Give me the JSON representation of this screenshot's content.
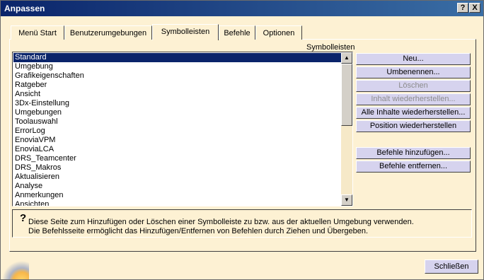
{
  "window": {
    "title": "Anpassen",
    "help_label": "?",
    "close_label": "X"
  },
  "tabs": [
    {
      "label": "Menü Start"
    },
    {
      "label": "Benutzerumgebungen"
    },
    {
      "label": "Symbolleisten"
    },
    {
      "label": "Befehle"
    },
    {
      "label": "Optionen"
    }
  ],
  "active_tab": "Symbolleisten",
  "toolbars": {
    "title": "Symbolleisten",
    "selected": "Standard",
    "items": [
      "Standard",
      "Umgebung",
      "Grafikeigenschaften",
      "Ratgeber",
      "Ansicht",
      "3Dx-Einstellung",
      "Umgebungen",
      "Toolauswahl",
      "ErrorLog",
      "EnoviaVPM",
      "EnoviaLCA",
      "DRS_Teamcenter",
      "DRS_Makros",
      "Aktualisieren",
      "Analyse",
      "Anmerkungen",
      "Ansichten"
    ]
  },
  "buttons": {
    "new": "Neu...",
    "rename": "Umbenennen...",
    "delete": "Löschen",
    "restore_content": "Inhalt wiederherstellen...",
    "restore_all": "Alle Inhalte wiederherstellen...",
    "restore_position": "Position wiederherstellen",
    "add_commands": "Befehle hinzufügen...",
    "remove_commands": "Befehle entfernen..."
  },
  "disabled_buttons": [
    "Löschen",
    "Inhalt wiederherstellen..."
  ],
  "info": {
    "icon": "question-mark-icon",
    "line1": "Diese Seite zum Hinzufügen oder Löschen einer Symbolleiste zu bzw. aus der aktuellen Umgebung verwenden.",
    "line2": "Die Befehlsseite ermöglicht das Hinzufügen/Entfernen von Befehlen durch Ziehen und Übergeben."
  },
  "footer": {
    "close_label": "Schließen"
  },
  "colors": {
    "titlebar": "#0a246a",
    "selection": "#0a246a",
    "background": "#fdf1d3",
    "button": "#d6d3ee"
  }
}
